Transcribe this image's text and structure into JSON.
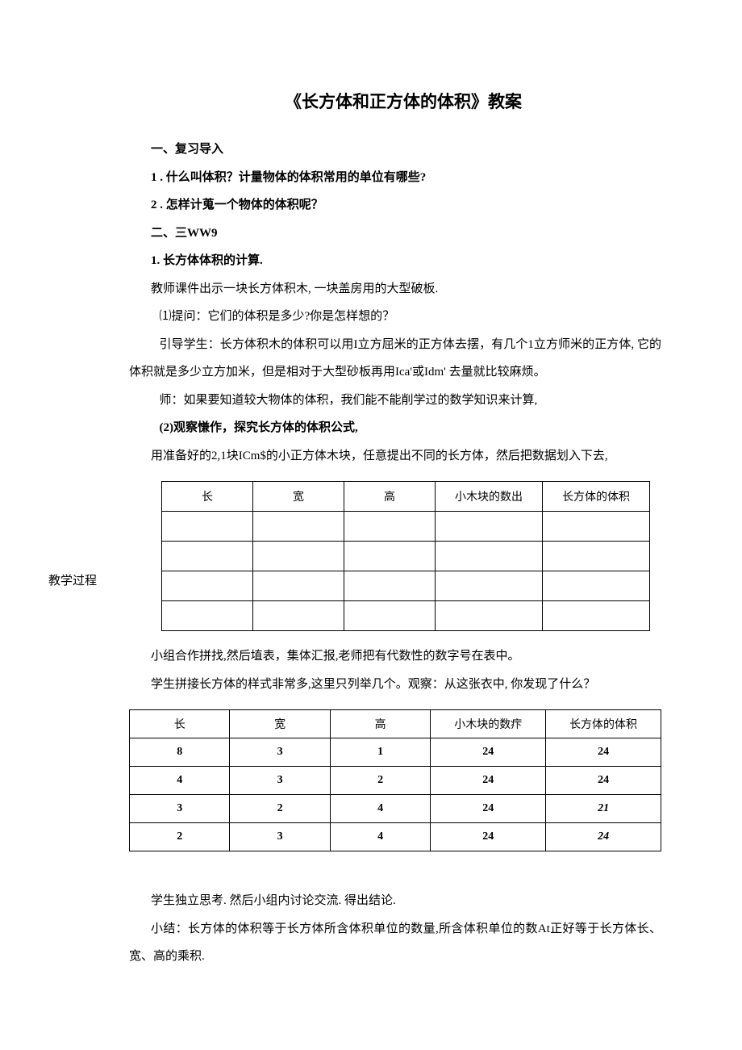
{
  "title": "《长方体和正方体的体积》教案",
  "side_label": "教学过程",
  "sec1_h": "一、复习导入",
  "sec1_p1": "1 . 什么叫体积？计量物体的体积常用的单位有哪些?",
  "sec1_p2": "2 . 怎样计蒐一个物体的体积呢？",
  "sec2_h": "二、三WW9",
  "sec2_p1": "1. 长方体体积的计算.",
  "sec2_p2": "教师课件出示一块长方体积木, 一块盖房用的大型破板.",
  "sec2_p3": "⑴提问：它们的体积是多少?你是怎样想的？",
  "sec2_p4": "引导学生：长方体积木的体积可以用I立方屈米的正方体去摆，有几个1立方师米的正方体, 它的体积就是多少立方加米，但是相对于大型砂板再用Ica'或Idm' 去量就比较麻烦。",
  "sec2_p5": "师：如果要知道较大物体的体积，我们能不能削学过的数学知识来计算,",
  "sec2_p6": "(2)观察慊作，探究长方体的体积公式,",
  "sec2_p7": "用准备好的2,1块ICm$的小正方体木块，任意提出不同的长方体，然后把数据划入下去,",
  "table1": {
    "headers": [
      "长",
      "宽",
      "高",
      "小木块的数出",
      "长方体的体积"
    ]
  },
  "sec3_p1": "小组合作拼找,然后埴表，集体汇报,老师把有代数性的数字号在表中。",
  "sec3_p2": "学生拼接长方体的样式非常多,这里只列举几个。观察：从这张衣中, 你发现了什么？",
  "table2": {
    "headers": [
      "长",
      "宽",
      "高",
      "小木块的数疜",
      "长方体的体积"
    ],
    "rows": [
      [
        "8",
        "3",
        "1",
        "24",
        "24"
      ],
      [
        "4",
        "3",
        "2",
        "24",
        "24"
      ],
      [
        "3",
        "2",
        "4",
        "24",
        "21"
      ],
      [
        "2",
        "3",
        "4",
        "24",
        "24"
      ]
    ]
  },
  "sec4_p1": "学生独立思考. 然后小组内讨论交流. 得出结论.",
  "sec4_p2": "小结：长方体的体积等于长方体所含体积单位的数量,所含体积单位的数At正好等于长方体长、宽、高的乘积."
}
